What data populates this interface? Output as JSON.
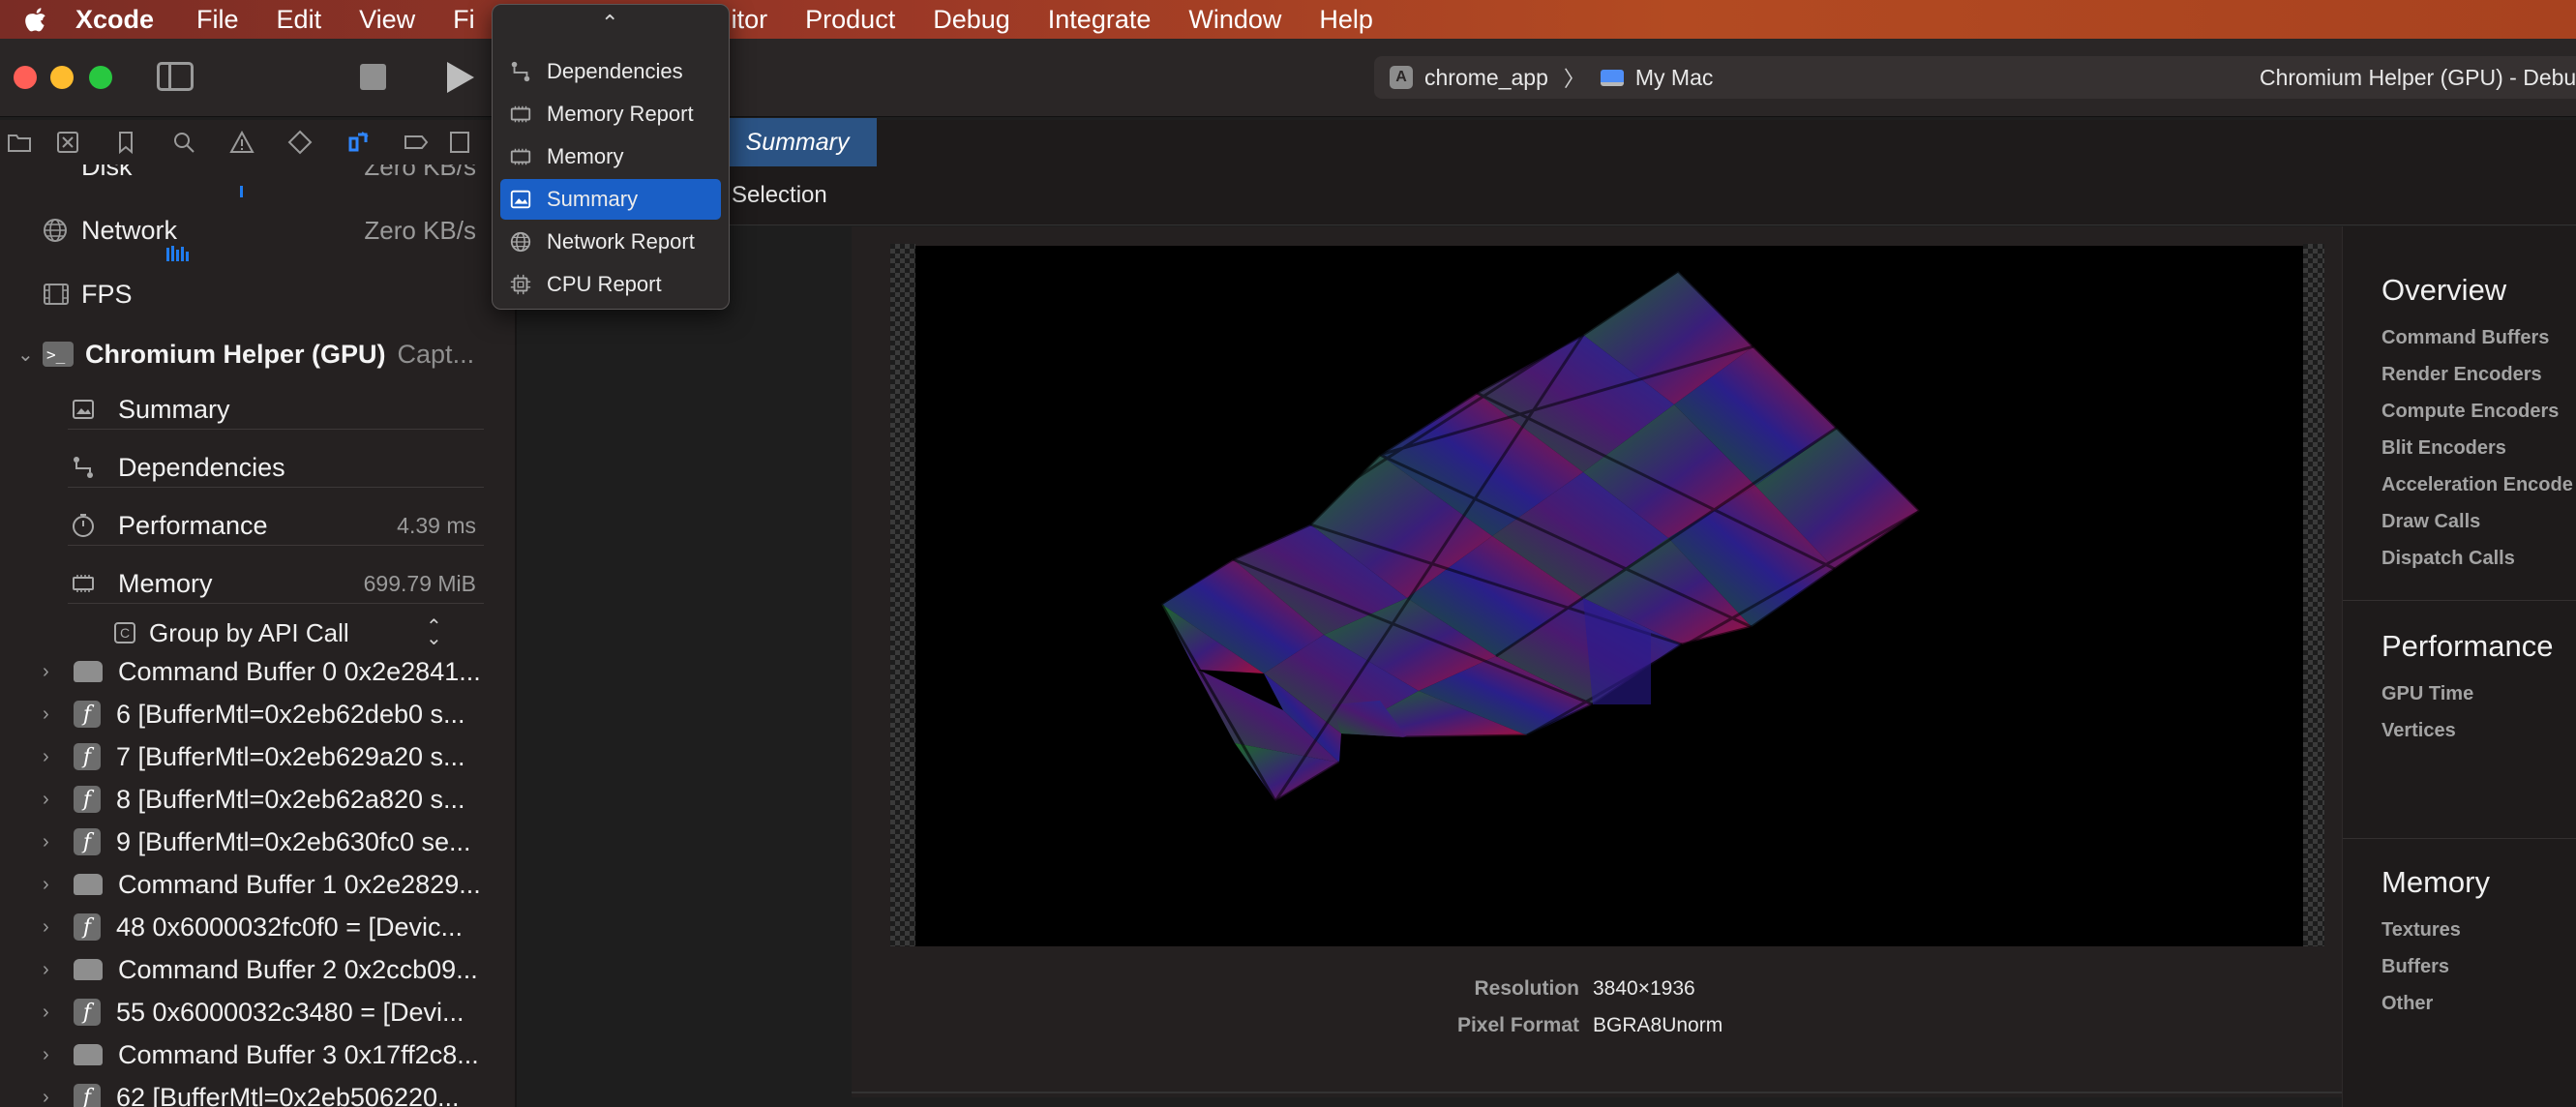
{
  "menubar": {
    "items": [
      "Xcode",
      "File",
      "Edit",
      "View",
      "Fi",
      "itor",
      "Product",
      "Debug",
      "Integrate",
      "Window",
      "Help"
    ]
  },
  "toolbar": {
    "scheme_target": "chrome_app",
    "scheme_destination": "My Mac",
    "status": "Chromium Helper (GPU) - Debu"
  },
  "sidebar": {
    "gauges": [
      {
        "label": "Disk",
        "value": "Zero KB/s"
      },
      {
        "label": "Network",
        "value": "Zero KB/s"
      },
      {
        "label": "FPS",
        "value": ""
      }
    ],
    "process": {
      "name": "Chromium Helper (GPU)",
      "detail": "Capt..."
    },
    "items": [
      {
        "label": "Summary",
        "value": "",
        "icon": "summary-icon"
      },
      {
        "label": "Dependencies",
        "value": "",
        "icon": "dependencies-icon"
      },
      {
        "label": "Performance",
        "value": "4.39 ms",
        "icon": "performance-icon"
      },
      {
        "label": "Memory",
        "value": "699.79 MiB",
        "icon": "memory-icon"
      }
    ],
    "group_by": "Group by API Call",
    "tree": [
      {
        "kind": "cmd",
        "label": "Command Buffer 0 0x2e2841..."
      },
      {
        "kind": "fn",
        "label": "6 [BufferMtl=0x2eb62deb0 s..."
      },
      {
        "kind": "fn",
        "label": "7 [BufferMtl=0x2eb629a20 s..."
      },
      {
        "kind": "fn",
        "label": "8 [BufferMtl=0x2eb62a820 s..."
      },
      {
        "kind": "fn",
        "label": "9 [BufferMtl=0x2eb630fc0 se..."
      },
      {
        "kind": "cmd",
        "label": "Command Buffer 1 0x2e2829..."
      },
      {
        "kind": "fn",
        "label": "48 0x6000032fc0f0 = [Devic..."
      },
      {
        "kind": "cmd",
        "label": "Command Buffer 2 0x2ccb09..."
      },
      {
        "kind": "fn",
        "label": "55 0x6000032c3480 = [Devi..."
      },
      {
        "kind": "cmd",
        "label": "Command Buffer 3 0x17ff2c8..."
      },
      {
        "kind": "fn",
        "label": "62 [BufferMtl=0x2eb506220..."
      }
    ]
  },
  "editor": {
    "tab": "Summary",
    "path_selection": "Selection"
  },
  "attachment": {
    "resolution_label": "Resolution",
    "resolution": "3840×1936",
    "pixel_format_label": "Pixel Format",
    "pixel_format": "BGRA8Unorm"
  },
  "outline": {
    "overview_title": "Overview",
    "overview_items": [
      "Command Buffers",
      "Render Encoders",
      "Compute Encoders",
      "Blit Encoders",
      "Acceleration Encode",
      "Draw Calls",
      "Dispatch Calls"
    ],
    "performance_title": "Performance",
    "performance_items": [
      "GPU Time",
      "Vertices"
    ],
    "memory_title": "Memory",
    "memory_items": [
      "Textures",
      "Buffers",
      "Other"
    ]
  },
  "menu": {
    "items": [
      {
        "label": "Dependencies",
        "icon": "dependencies-icon"
      },
      {
        "label": "Memory Report",
        "icon": "memory-report-icon"
      },
      {
        "label": "Memory",
        "icon": "memory-icon"
      },
      {
        "label": "Summary",
        "icon": "summary-icon",
        "selected": true
      },
      {
        "label": "Network Report",
        "icon": "network-report-icon"
      },
      {
        "label": "CPU Report",
        "icon": "cpu-report-icon"
      }
    ]
  },
  "colors": {
    "accent": "#1a5fc6",
    "tab_selected": "#2b5384",
    "menubar_gradient": [
      "#7a2c25",
      "#b34a22"
    ]
  }
}
